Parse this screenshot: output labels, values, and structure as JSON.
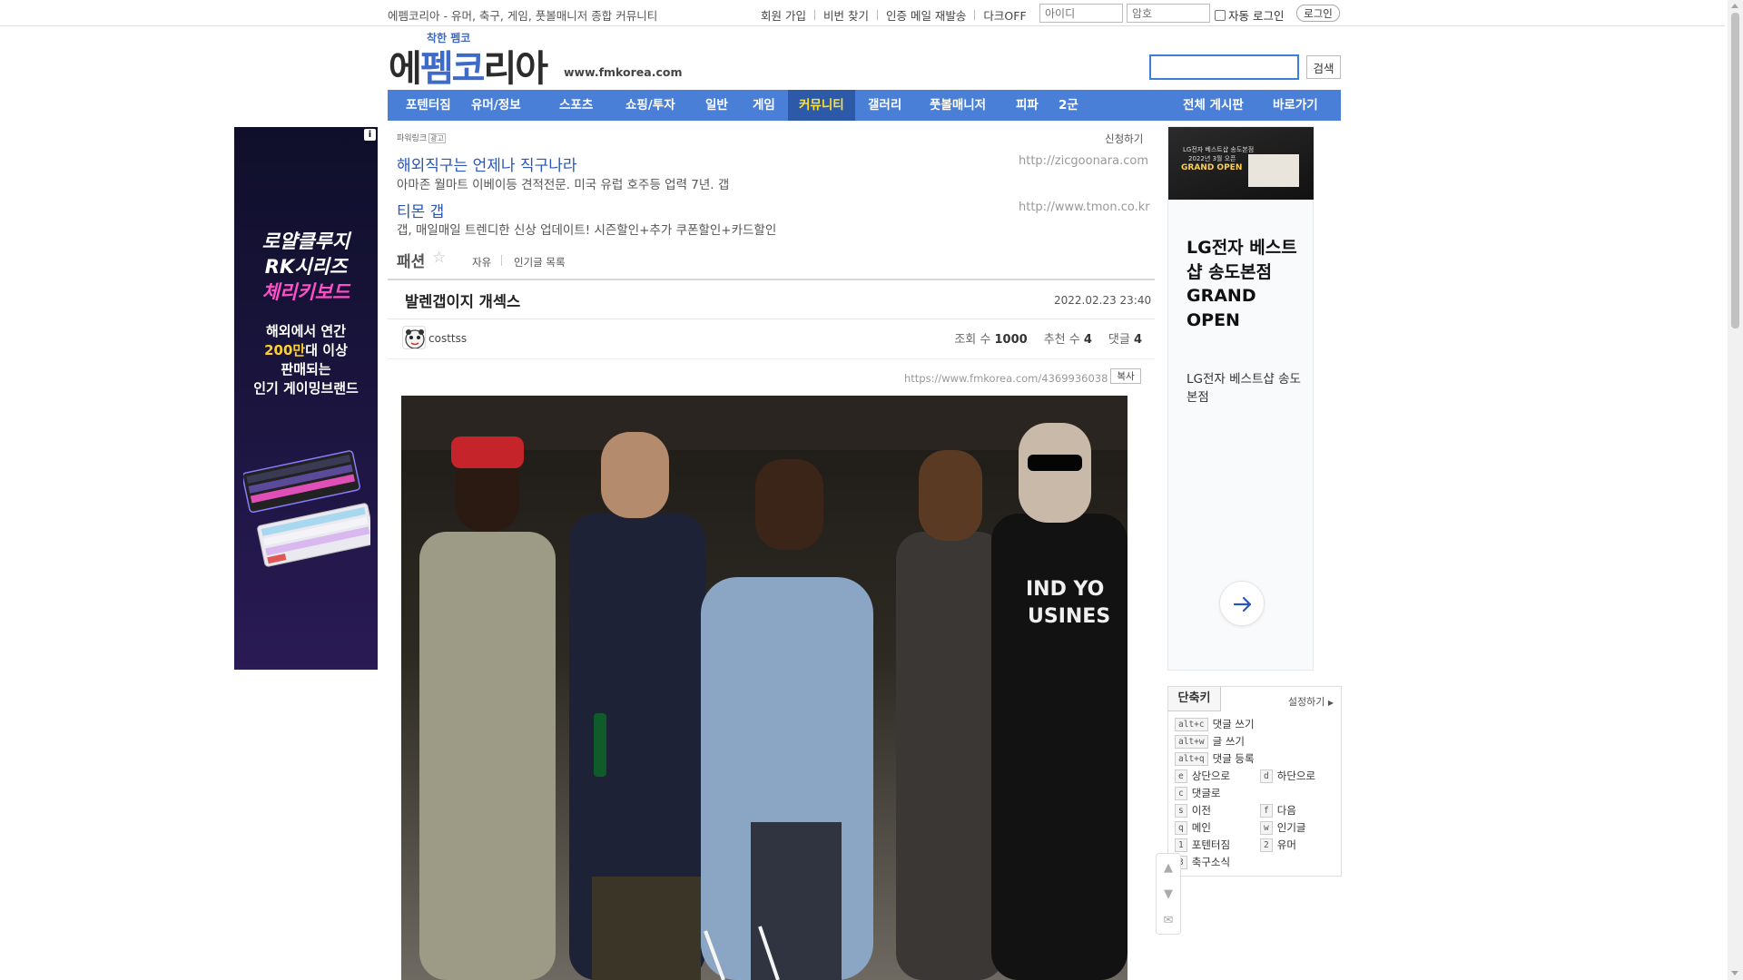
{
  "topbar": {
    "tagline": "에펨코리아 - 유머, 축구, 게임, 풋볼매니저 종합 커뮤니티",
    "links": [
      "회원 가입",
      "비번 찾기",
      "인증 메일 재발송",
      "다크OFF"
    ],
    "id_placeholder": "아이디",
    "pw_placeholder": "암호",
    "autologin_label": "자동 로그인",
    "login_button": "로그인"
  },
  "header": {
    "logo_sub": "착한 펨코",
    "logo_main_a": "에",
    "logo_main_b": "펨",
    "logo_main_c": "코",
    "logo_main_d": "리아",
    "domain": "www.fmkorea.com",
    "search_button": "검색"
  },
  "nav": {
    "items": [
      "포텐터짐",
      "유머/정보",
      "스포츠",
      "쇼핑/투자",
      "일반",
      "게임",
      "커뮤니티",
      "갤러리",
      "풋볼매니저",
      "피파",
      "2군"
    ],
    "active": "커뮤니티",
    "right_items": [
      "전체 게시판",
      "바로가기"
    ]
  },
  "left_ad": {
    "line1": "로얄클루지",
    "line2": "RK시리즈",
    "line3": "체리키보드",
    "line4": "해외에서 연간",
    "line5a": "200만",
    "line5b": "대 이상",
    "line6": "판매되는",
    "line7": "인기 게이밍브랜드",
    "info_icon": "info-icon"
  },
  "powerlink": {
    "label": "파워링크",
    "label_badge": "광고",
    "apply": "신청하기",
    "ads": [
      {
        "title": "해외직구는 언제나 직구나라",
        "url": "http://zicgoonara.com",
        "desc": "아마존 월마트 이베이등 견적전문. 미국 유럽 호주등 업력 7년. 갭"
      },
      {
        "title": "티몬 갭",
        "url": "http://www.tmon.co.kr",
        "desc": "갭, 매일매일 트렌디한 신상 업데이트! 시즌할인+추가 쿠폰할인+카드할인"
      }
    ]
  },
  "board": {
    "name": "패션",
    "links": [
      "자유",
      "인기글 목록"
    ]
  },
  "post": {
    "title": "발렌갭이지 개섹스",
    "date": "2022.02.23 23:40",
    "author": "costtss",
    "views_label": "조회 수",
    "views": "1000",
    "recommend_label": "추천 수",
    "recommend": "4",
    "comments_label": "댓글",
    "comments": "4",
    "url": "https://www.fmkorea.com/4369936038",
    "copy_button": "복사"
  },
  "right_ad": {
    "image_text1": "LG전자 베스트샵 송도본점",
    "image_text2": "2022년 3월 오픈",
    "image_text3": "GRAND OPEN",
    "title": "LG전자 베스트샵 송도본점 GRAND OPEN",
    "subtitle": "LG전자 베스트샵 송도본점"
  },
  "shortcuts": {
    "title": "단축키",
    "settings": "설정하기",
    "items": [
      {
        "key": "alt+c",
        "label": "댓글 쓰기"
      },
      {
        "key": "alt+w",
        "label": "글 쓰기"
      },
      {
        "key": "alt+q",
        "label": "댓글 등록"
      },
      {
        "key": "e",
        "label": "상단으로"
      },
      {
        "key": "d",
        "label": "하단으로"
      },
      {
        "key": "c",
        "label": "댓글로"
      },
      {
        "key": "s",
        "label": "이전"
      },
      {
        "key": "f",
        "label": "다음"
      },
      {
        "key": "q",
        "label": "메인"
      },
      {
        "key": "w",
        "label": "인기글"
      },
      {
        "key": "1",
        "label": "포텐터짐"
      },
      {
        "key": "2",
        "label": "유머"
      },
      {
        "key": "3",
        "label": "축구소식"
      }
    ]
  }
}
